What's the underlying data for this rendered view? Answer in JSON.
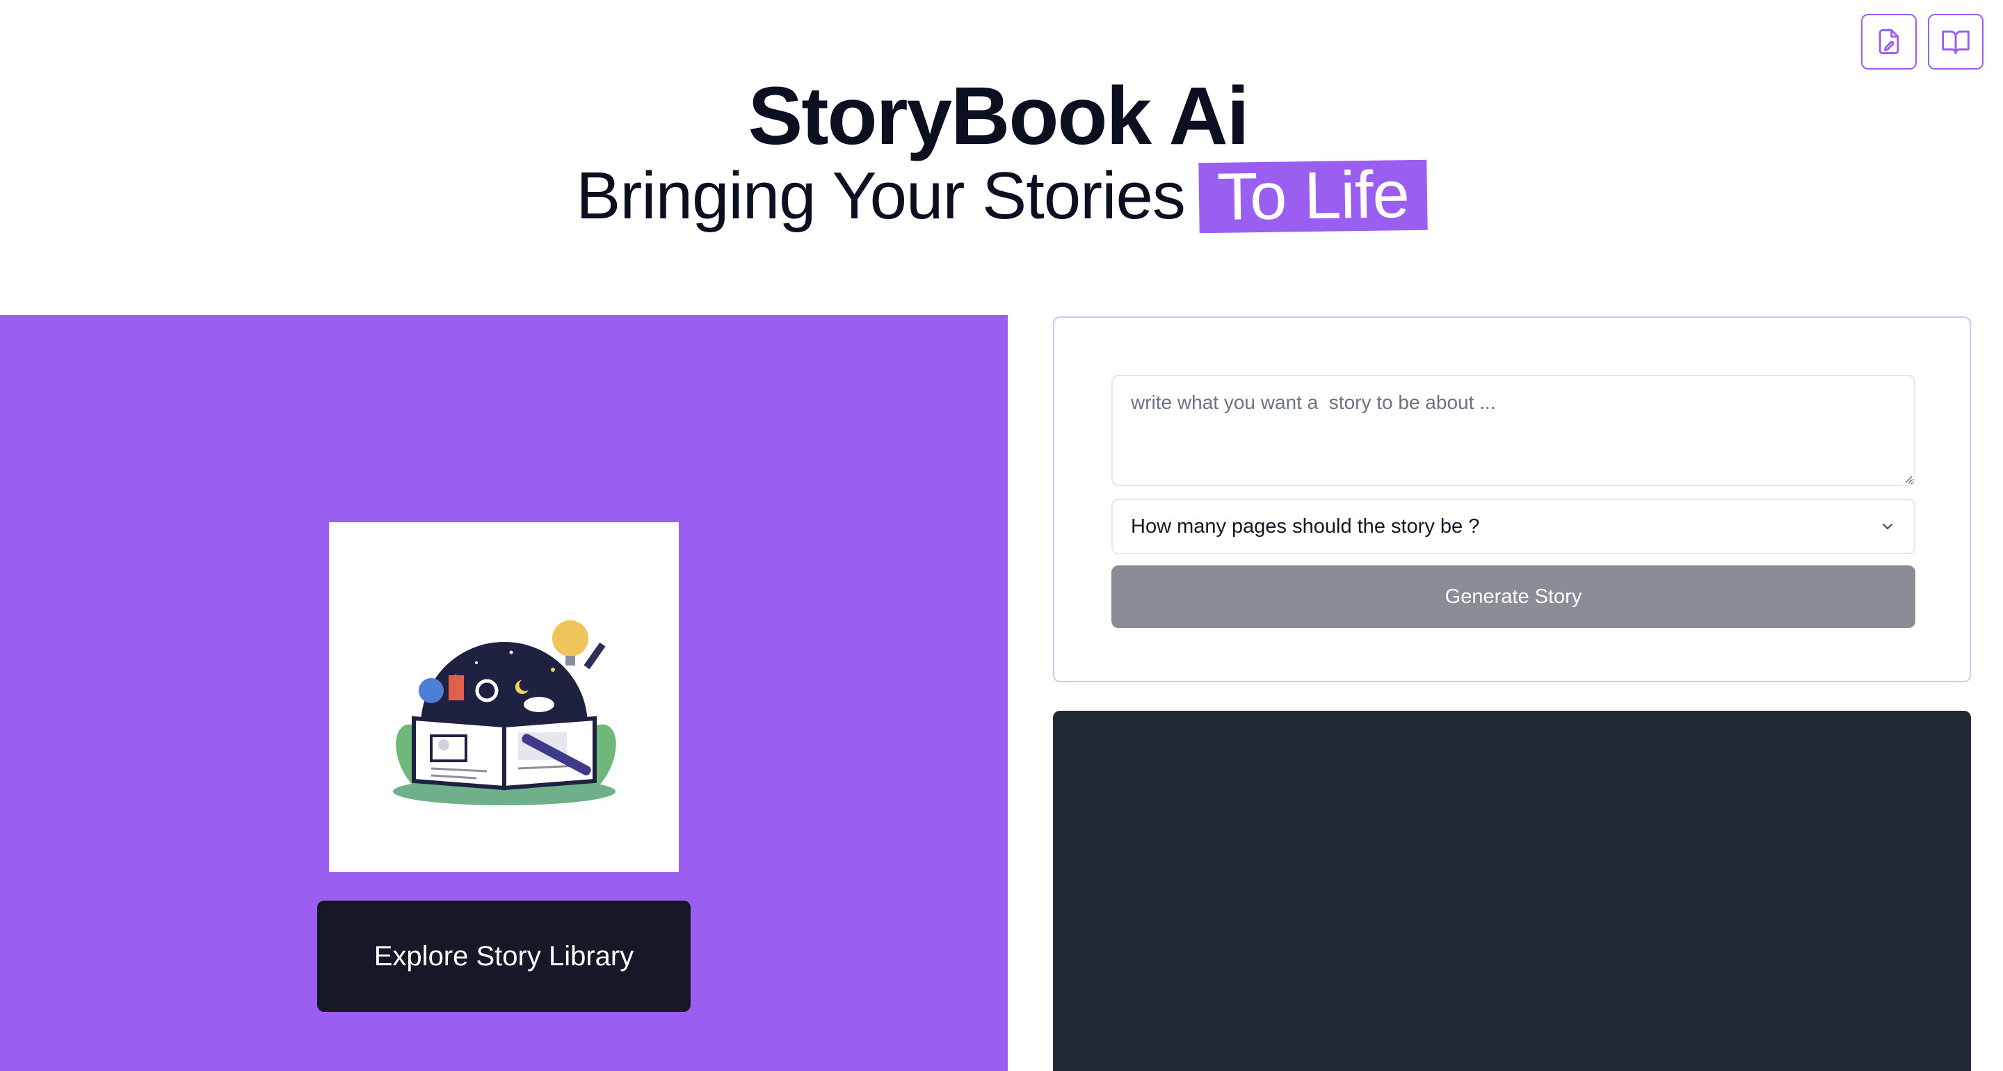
{
  "header": {
    "actions": [
      {
        "icon": "file-edit-icon",
        "color": "#9a5ff0"
      },
      {
        "icon": "open-book-icon",
        "color": "#9a5ff0"
      }
    ]
  },
  "hero": {
    "title": "StoryBook Ai",
    "subtitle": "Bringing Your Stories",
    "highlight": "To Life"
  },
  "library": {
    "cover_icon": "open-book-illustration",
    "explore_label": "Explore Story Library"
  },
  "form": {
    "prompt_placeholder": "write what you want a  story to be about ...",
    "prompt_value": "",
    "pages_select_label": "How many pages should the story be ?",
    "generate_label": "Generate Story"
  },
  "colors": {
    "accent": "#9a5ff0",
    "dark_button": "#151826",
    "disabled_button": "#8a8d96",
    "preview_bg": "#222834"
  }
}
